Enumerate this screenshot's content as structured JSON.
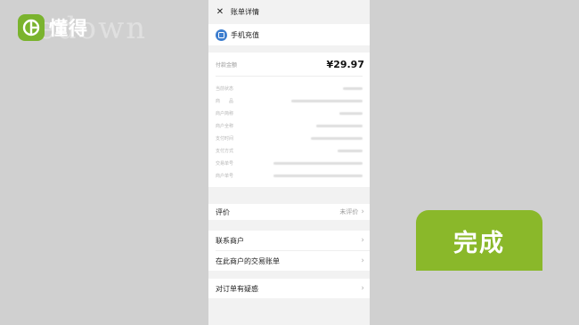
{
  "brand": {
    "name": "懂得",
    "watermark": "dedown"
  },
  "titlebar": {
    "title": "账单详情"
  },
  "merchant": {
    "name": "手机充值"
  },
  "payment": {
    "label": "付款金额",
    "amount": "¥29.97"
  },
  "details": [
    {
      "label": "当前状态"
    },
    {
      "label": "商　　品"
    },
    {
      "label": "商户简称"
    },
    {
      "label": "商户全称"
    },
    {
      "label": "支付时间"
    },
    {
      "label": "支付方式"
    },
    {
      "label": "交易单号"
    },
    {
      "label": "商户单号"
    }
  ],
  "rating": {
    "label": "评价",
    "value": "未评价"
  },
  "actions": {
    "contact": "联系商户",
    "bills": "在此商户的交易账单",
    "query": "对订单有疑惑"
  },
  "overlay": {
    "done": "完成"
  },
  "colors": {
    "brand_green": "#7ab32e",
    "done_green": "#8ab82a",
    "icon_blue": "#3d7ecf"
  }
}
